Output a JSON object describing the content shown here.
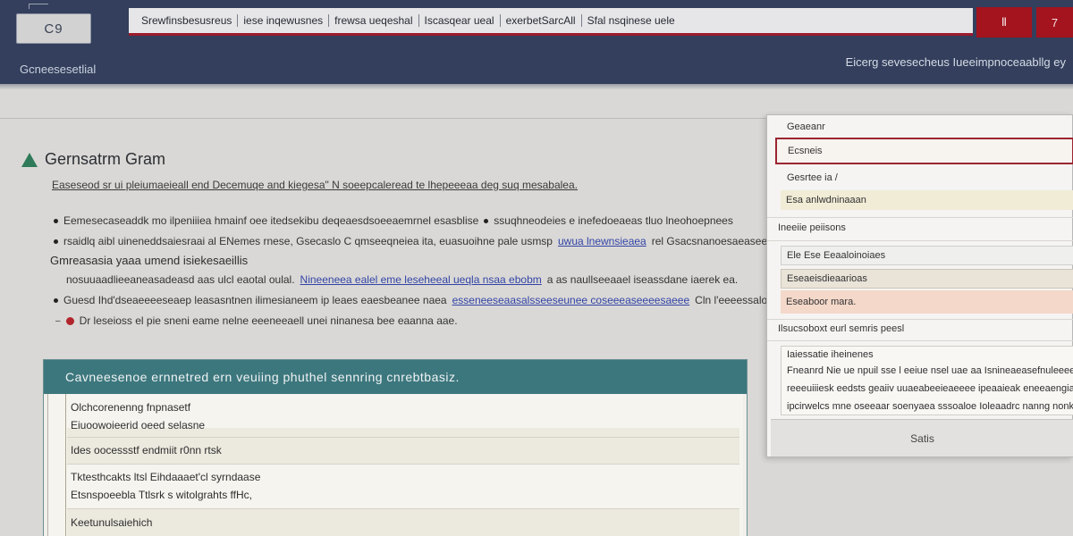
{
  "header": {
    "ident": "C9",
    "tabs": [
      "Srewfinsbesusreus",
      "iese inqewusnes",
      "frewsa ueqeshal",
      "Iscasqear ueal",
      "exerbetSarcAll",
      "Sfal nsqinese uele"
    ],
    "btn1": "Ⅱ",
    "btn2": "7",
    "left_caption": "Gcneesesetlial",
    "right_caption": "Eicerg sevesecheus Iueeimpnoceaabllg ey"
  },
  "main": {
    "title": "Gernsatrm Gram",
    "intro": "Easeseod sr ui pleiumaeieall end Decemuqe and kiegesa\" N soeepcaleread te lhepeeeaa deg suq mesabalea.",
    "bullets": [
      {
        "text": "Eemesecaseaddk mo ilpeniiiea hmainf oee itedsekibu deqeaesdsoeeaemrnel esasblise",
        "tail": "ssuqhneodeies  e  inefedoeaeas  tluo lneohoepnees"
      },
      {
        "text": "rsaidlq aibl uineneddsaiesraai al ENemes rnese, Gsecaslo C qmseeqneiea ita, euasuoihne pale usmsp",
        "link": "uwua lnewnsieaea",
        "tail": "rel Gsacsnanoesaeaseea seesnenel ooe"
      }
    ],
    "sub_heading": "Gmreasasia yaaa umend isiekesaeillis",
    "sub_row_1": "nosuuaadlieeaneasadeasd aas ulcl eaotal oulal.",
    "sub_row_1_link": "Nineeneea ealel eme leseheeal ueqla nsaa ebobm",
    "sub_row_1_tail": "a as naullseeaael  iseassdane iaerek ea.",
    "sub_row_2": "Guesd Ihd'dseaeeeeseaep leasasntnen ilimesianeem ip leaes eaesbeanee naea",
    "sub_row_2_link": "esseneeseaasalsseeseunee  coseeeaseeeesaeee",
    "sub_row_2_tail": "Cln l'eeeessaloees ad lm eeseael  nassse  n",
    "warn_text": "Dr leseioss el pie sneni eame nelne eeeneeaell unei ninanesa bee eaanna aae."
  },
  "content_box": {
    "heading": "Cavneesenoe ernnetred ern veuiing phuthel sennring  cnrebtbasiz.",
    "rows": [
      "Olchcorenenng fnpnasetf",
      "Eiuoowoieerid oeed selasne",
      "Ides oocessstf endmiit r0nn rtsk",
      "Tktesthcakts ltsl Eihdaaaet'cl syrndaase",
      "Etsnspoeebla Ttlsrk s witolgrahts ffHc,",
      "Keetunulsaiehich"
    ]
  },
  "panel": {
    "label_top": "Geaeanr",
    "input_value": "Ecsneis",
    "small_label": "Gesrtee ia /",
    "row_tinted": "Esa anlwdninaaan",
    "section_1": "Ineeiie peiisons",
    "row_a": "Ele  Ese  Eeaaloinoiaes",
    "row_b": "Eseaeisdieaarioas",
    "row_c": "Eseaboor mara.",
    "section_2": "Ilsucsoboxt eurl semris peesl",
    "textarea_label": "Iaiessatie  iheinenes",
    "textarea_lines": [
      "Fneanrd  Nie ue  npuil  sse l eeiue  nsel uae aa  Isnineaeasefnuleeeeeeias",
      "reeeuiiiesk  eedsts  geaiiv  uuaeabeeieaeeee  ipeaaieak eneeaengiaaoe",
      "ipcirwelcs  mne  oseeaar  soenyaea sssoaloe Ioleaadrc nanng  nonkeaei  ihnaa"
    ],
    "footer_btn": "Satis"
  }
}
